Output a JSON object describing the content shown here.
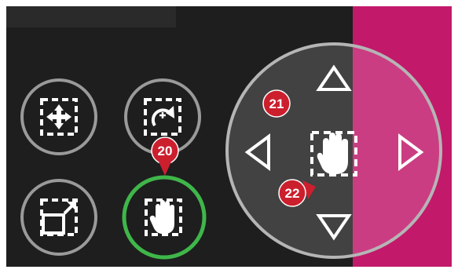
{
  "colors": {
    "background": "#1e1e1e",
    "topbar": "#2a2a2a",
    "panel_accent": "#c2196b",
    "ring_gray": "#9a9a9a",
    "active_ring": "#3fb64a",
    "icon_white": "#ffffff",
    "callout_red": "#cc1f2e"
  },
  "buttons": [
    {
      "name": "move-mode-button",
      "icon": "move-arrows-icon",
      "active": false
    },
    {
      "name": "rotate-mode-button",
      "icon": "rotate-icon",
      "active": false
    },
    {
      "name": "resize-mode-button",
      "icon": "resize-icon",
      "active": false
    },
    {
      "name": "pan-mode-button",
      "icon": "hand-icon",
      "active": true
    }
  ],
  "direction_pad": {
    "arrows": [
      "up-arrow-icon",
      "left-arrow-icon",
      "right-arrow-icon",
      "down-arrow-icon"
    ],
    "center_icon": "hand-icon"
  },
  "callouts": {
    "c20": "20",
    "c21": "21",
    "c22": "22"
  }
}
